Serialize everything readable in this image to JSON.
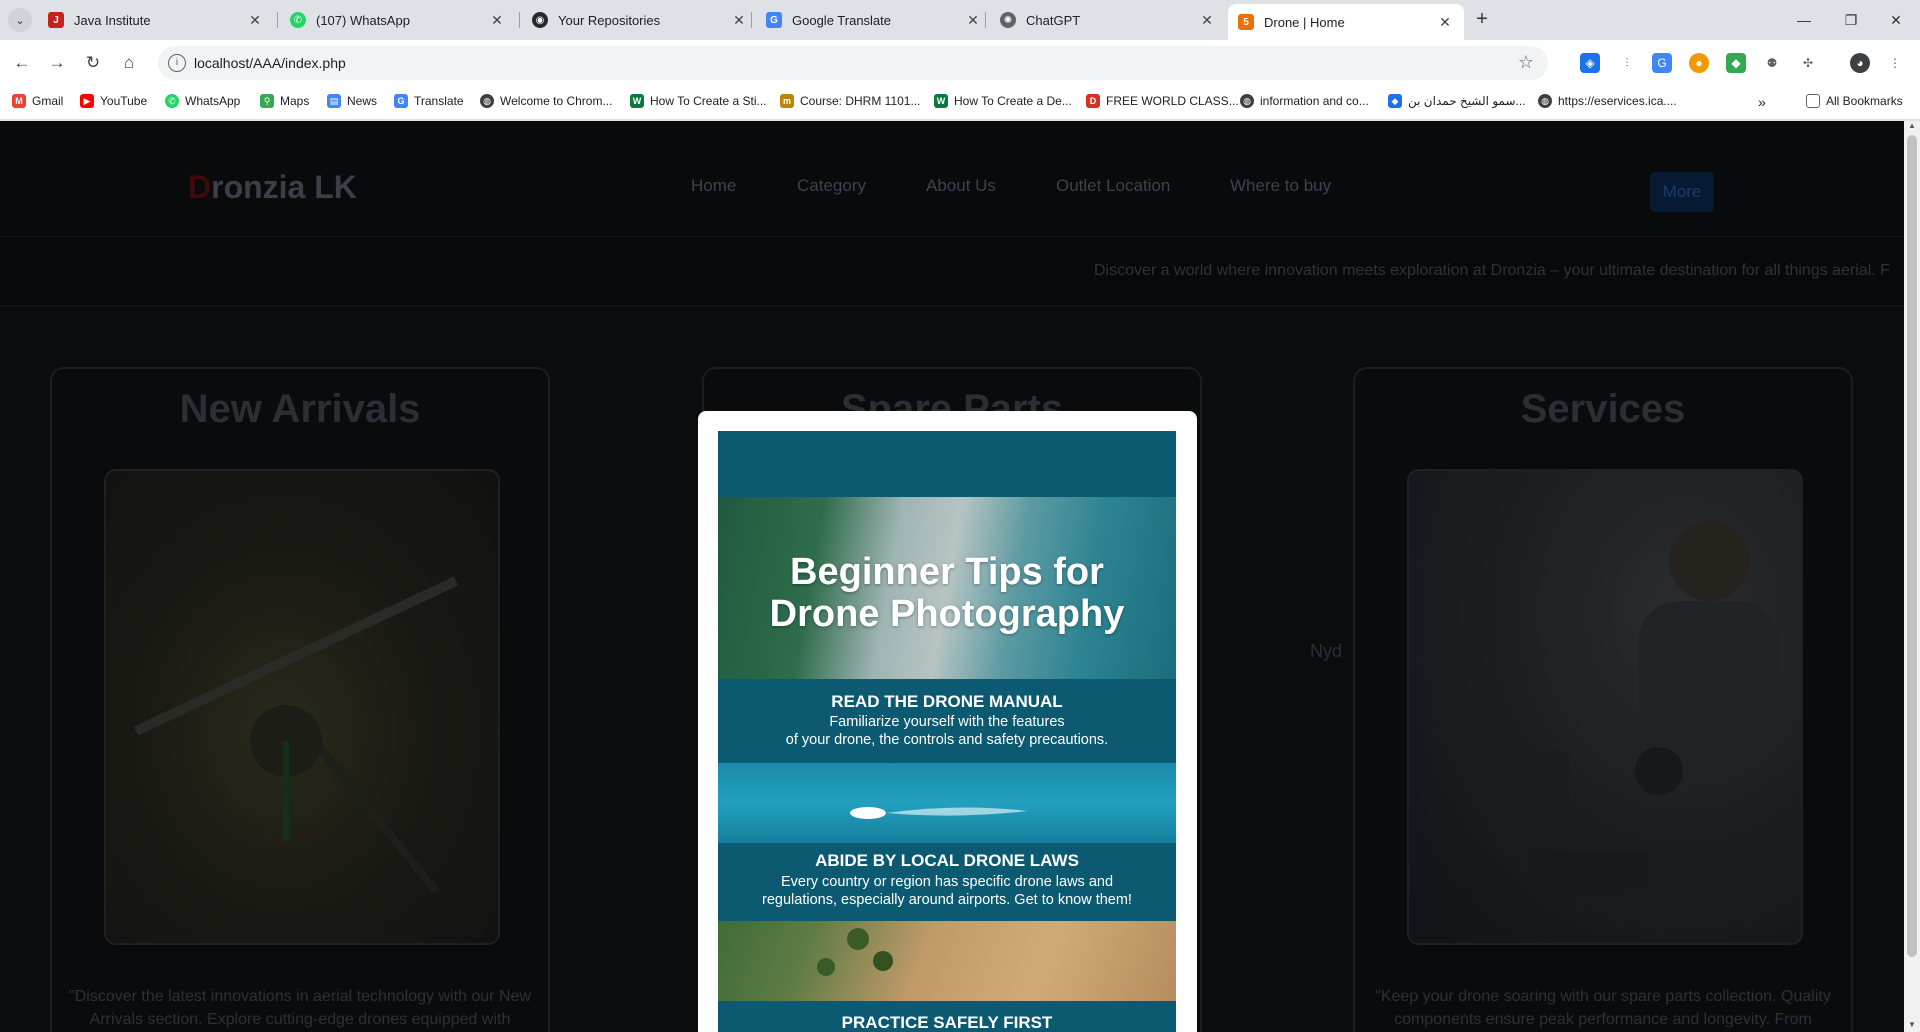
{
  "browser": {
    "tabs": [
      {
        "title": "Java Institute",
        "icon": "java-institute-icon",
        "color": "#c5221f"
      },
      {
        "title": "(107) WhatsApp",
        "icon": "whatsapp-icon",
        "color": "#25d366"
      },
      {
        "title": "Your Repositories",
        "icon": "github-icon",
        "color": "#24292f"
      },
      {
        "title": "Google Translate",
        "icon": "google-translate-icon",
        "color": "#4285f4"
      },
      {
        "title": "ChatGPT",
        "icon": "chatgpt-icon",
        "color": "#5f6368"
      },
      {
        "title": "Drone | Home",
        "icon": "html-file-icon",
        "color": "#e8710a",
        "active": true
      }
    ],
    "url": "localhost/AAA/index.php",
    "bookmarks": [
      {
        "label": "Gmail",
        "color": "#ea4335"
      },
      {
        "label": "YouTube",
        "color": "#ff0000"
      },
      {
        "label": "WhatsApp",
        "color": "#25d366"
      },
      {
        "label": "Maps",
        "color": "#34a853"
      },
      {
        "label": "News",
        "color": "#4285f4"
      },
      {
        "label": "Translate",
        "color": "#4285f4"
      },
      {
        "label": "Welcome to Chrom...",
        "color": "#3c4043"
      },
      {
        "label": "How To Create a Sti...",
        "color": "#0a7a3c"
      },
      {
        "label": "Course: DHRM 1101...",
        "color": "#b8860b"
      },
      {
        "label": "How To Create a De...",
        "color": "#0a7a3c"
      },
      {
        "label": "FREE WORLD CLASS...",
        "color": "#d93025"
      },
      {
        "label": "information and co...",
        "color": "#3c4043"
      },
      {
        "label": "سمو الشيخ حمدان بن...",
        "color": "#1a73e8"
      },
      {
        "label": "https://eservices.ica....",
        "color": "#3c4043"
      }
    ],
    "all_bookmarks": "All Bookmarks"
  },
  "site": {
    "brand_first": "D",
    "brand_rest": "ronzia LK",
    "menu": [
      "Home",
      "Category",
      "About Us",
      "Outlet Location",
      "Where to buy"
    ],
    "more": "More",
    "marquee": "Discover a world where innovation meets exploration at Dronzia – your ultimate destination for all things aerial. F",
    "cards": [
      {
        "title": "New Arrivals",
        "desc": "\"Discover the latest innovations in aerial technology with our New Arrivals section. Explore cutting-edge drones equipped with"
      },
      {
        "title": "Spare Parts",
        "desc": ""
      },
      {
        "title": "Services",
        "desc": "\"Keep your drone soaring with our spare parts collection. Quality components ensure peak performance and longevity. From"
      }
    ],
    "ghost_text": "Nyd"
  },
  "modal": {
    "title_line1": "Beginner Tips for",
    "title_line2": "Drone Photography",
    "tips": [
      {
        "heading": "READ THE DRONE MANUAL",
        "line1": "Familiarize yourself with the features",
        "line2": "of your drone, the controls and safety precautions."
      },
      {
        "heading": "ABIDE BY LOCAL DRONE LAWS",
        "line1": "Every country or region has specific drone laws and",
        "line2": "regulations, especially around airports. Get to know them!"
      },
      {
        "heading": "PRACTICE SAFELY FIRST",
        "line1": "",
        "line2": ""
      }
    ]
  }
}
